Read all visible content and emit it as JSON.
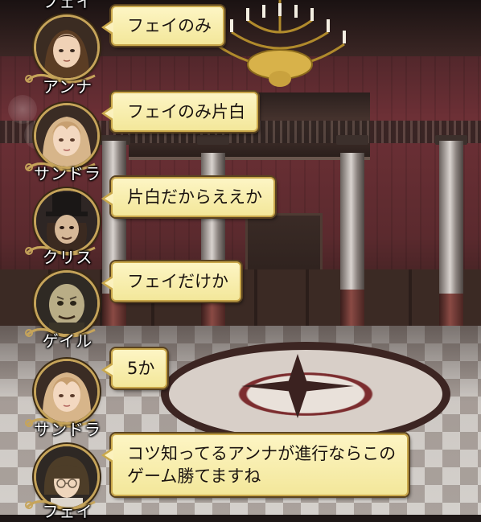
{
  "scene": "mansion-hall",
  "colors": {
    "bubble_fill": "#f8eeb0",
    "bubble_border": "#c9a74a",
    "name_text": "#ffffff",
    "avatar_frame": "#c6a45a"
  },
  "chat": {
    "top_partial_name": "フェイ",
    "messages": [
      {
        "speaker": "アンナ",
        "avatar_icon": "anna-portrait-icon",
        "text": "フェイのみ"
      },
      {
        "speaker": "サンドラ",
        "avatar_icon": "sandra-portrait-icon",
        "text": "フェイのみ片白"
      },
      {
        "speaker": "クリス",
        "avatar_icon": "chris-portrait-icon",
        "text": "片白だからええか"
      },
      {
        "speaker": "ゲイル",
        "avatar_icon": "gale-portrait-icon",
        "text": "フェイだけか"
      },
      {
        "speaker": "サンドラ",
        "avatar_icon": "sandra-portrait-icon",
        "text": "5か"
      },
      {
        "speaker": "フェイ",
        "avatar_icon": "faye-portrait-icon",
        "text": "コツ知ってるアンナが進行ならこの\nゲーム勝てますね"
      }
    ]
  }
}
